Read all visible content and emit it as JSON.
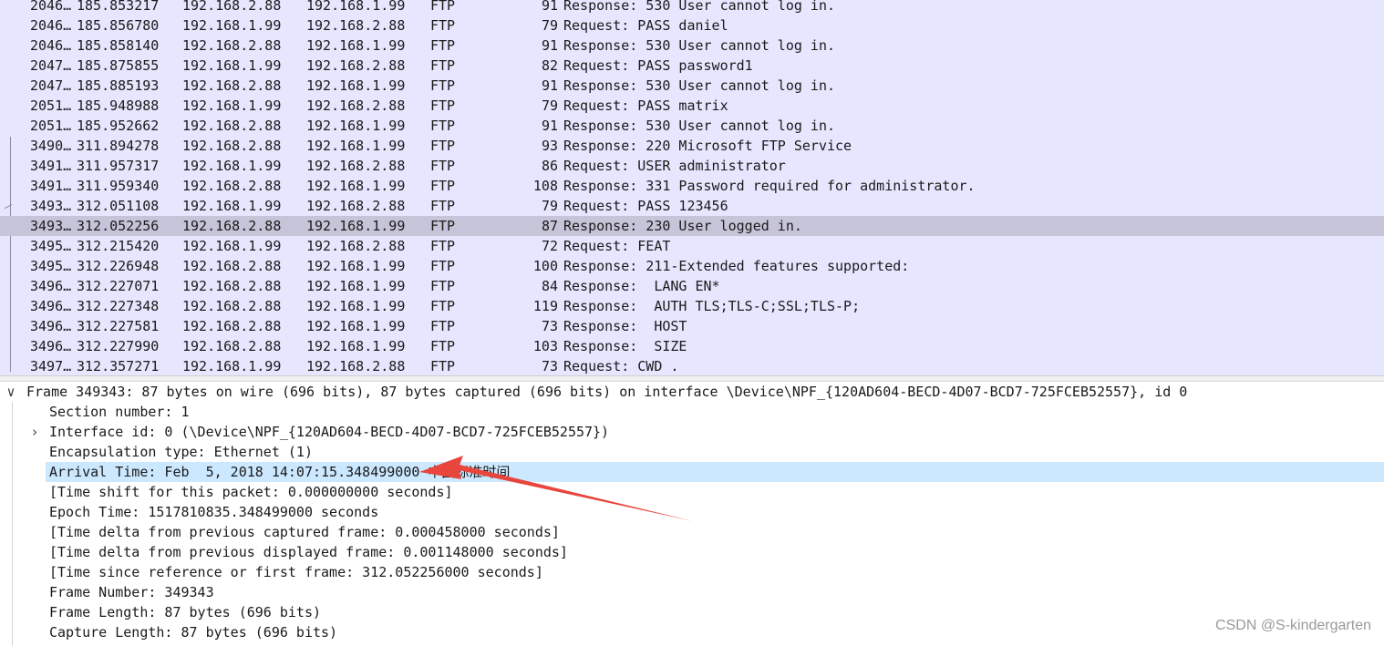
{
  "packets": [
    {
      "no": "2046…",
      "time": "185.853217",
      "src": "192.168.2.88",
      "dst": "192.168.1.99",
      "proto": "FTP",
      "len": "91",
      "info": "Response: 530 User cannot log in."
    },
    {
      "no": "2046…",
      "time": "185.856780",
      "src": "192.168.1.99",
      "dst": "192.168.2.88",
      "proto": "FTP",
      "len": "79",
      "info": "Request: PASS daniel"
    },
    {
      "no": "2046…",
      "time": "185.858140",
      "src": "192.168.2.88",
      "dst": "192.168.1.99",
      "proto": "FTP",
      "len": "91",
      "info": "Response: 530 User cannot log in."
    },
    {
      "no": "2047…",
      "time": "185.875855",
      "src": "192.168.1.99",
      "dst": "192.168.2.88",
      "proto": "FTP",
      "len": "82",
      "info": "Request: PASS password1"
    },
    {
      "no": "2047…",
      "time": "185.885193",
      "src": "192.168.2.88",
      "dst": "192.168.1.99",
      "proto": "FTP",
      "len": "91",
      "info": "Response: 530 User cannot log in."
    },
    {
      "no": "2051…",
      "time": "185.948988",
      "src": "192.168.1.99",
      "dst": "192.168.2.88",
      "proto": "FTP",
      "len": "79",
      "info": "Request: PASS matrix"
    },
    {
      "no": "2051…",
      "time": "185.952662",
      "src": "192.168.2.88",
      "dst": "192.168.1.99",
      "proto": "FTP",
      "len": "91",
      "info": "Response: 530 User cannot log in."
    },
    {
      "no": "3490…",
      "time": "311.894278",
      "src": "192.168.2.88",
      "dst": "192.168.1.99",
      "proto": "FTP",
      "len": "93",
      "info": "Response: 220 Microsoft FTP Service"
    },
    {
      "no": "3491…",
      "time": "311.957317",
      "src": "192.168.1.99",
      "dst": "192.168.2.88",
      "proto": "FTP",
      "len": "86",
      "info": "Request: USER administrator"
    },
    {
      "no": "3491…",
      "time": "311.959340",
      "src": "192.168.2.88",
      "dst": "192.168.1.99",
      "proto": "FTP",
      "len": "108",
      "info": "Response: 331 Password required for administrator."
    },
    {
      "no": "3493…",
      "time": "312.051108",
      "src": "192.168.1.99",
      "dst": "192.168.2.88",
      "proto": "FTP",
      "len": "79",
      "info": "Request: PASS 123456"
    },
    {
      "no": "3493…",
      "time": "312.052256",
      "src": "192.168.2.88",
      "dst": "192.168.1.99",
      "proto": "FTP",
      "len": "87",
      "info": "Response: 230 User logged in.",
      "selected": true
    },
    {
      "no": "3495…",
      "time": "312.215420",
      "src": "192.168.1.99",
      "dst": "192.168.2.88",
      "proto": "FTP",
      "len": "72",
      "info": "Request: FEAT"
    },
    {
      "no": "3495…",
      "time": "312.226948",
      "src": "192.168.2.88",
      "dst": "192.168.1.99",
      "proto": "FTP",
      "len": "100",
      "info": "Response: 211-Extended features supported:"
    },
    {
      "no": "3496…",
      "time": "312.227071",
      "src": "192.168.2.88",
      "dst": "192.168.1.99",
      "proto": "FTP",
      "len": "84",
      "info": "Response:  LANG EN*"
    },
    {
      "no": "3496…",
      "time": "312.227348",
      "src": "192.168.2.88",
      "dst": "192.168.1.99",
      "proto": "FTP",
      "len": "119",
      "info": "Response:  AUTH TLS;TLS-C;SSL;TLS-P;"
    },
    {
      "no": "3496…",
      "time": "312.227581",
      "src": "192.168.2.88",
      "dst": "192.168.1.99",
      "proto": "FTP",
      "len": "73",
      "info": "Response:  HOST"
    },
    {
      "no": "3496…",
      "time": "312.227990",
      "src": "192.168.2.88",
      "dst": "192.168.1.99",
      "proto": "FTP",
      "len": "103",
      "info": "Response:  SIZE"
    },
    {
      "no": "3497…",
      "time": "312.357271",
      "src": "192.168.1.99",
      "dst": "192.168.2.88",
      "proto": "FTP",
      "len": "73",
      "info": "Request: CWD ."
    }
  ],
  "details": {
    "frame_summary": "Frame 349343: 87 bytes on wire (696 bits), 87 bytes captured (696 bits) on interface \\Device\\NPF_{120AD604-BECD-4D07-BCD7-725FCEB52557}, id 0",
    "section_number": "Section number: 1",
    "interface_id": "Interface id: 0 (\\Device\\NPF_{120AD604-BECD-4D07-BCD7-725FCEB52557})",
    "encapsulation": "Encapsulation type: Ethernet (1)",
    "arrival_time": "Arrival Time: Feb  5, 2018 14:07:15.348499000 中国标准时间",
    "time_shift": "[Time shift for this packet: 0.000000000 seconds]",
    "epoch_time": "Epoch Time: 1517810835.348499000 seconds",
    "delta_captured": "[Time delta from previous captured frame: 0.000458000 seconds]",
    "delta_displayed": "[Time delta from previous displayed frame: 0.001148000 seconds]",
    "time_since_ref": "[Time since reference or first frame: 312.052256000 seconds]",
    "frame_number": "Frame Number: 349343",
    "frame_length": "Frame Length: 87 bytes (696 bits)",
    "capture_length": "Capture Length: 87 bytes (696 bits)"
  },
  "icons": {
    "expanded": "∨",
    "collapsed": "›"
  },
  "watermark": "CSDN @S-kindergarten",
  "colors": {
    "list_bg": "#e7e6ff",
    "selected_row": "#c6c4d8",
    "highlight_row": "#cce8ff",
    "annotation_arrow": "#e8453c"
  }
}
